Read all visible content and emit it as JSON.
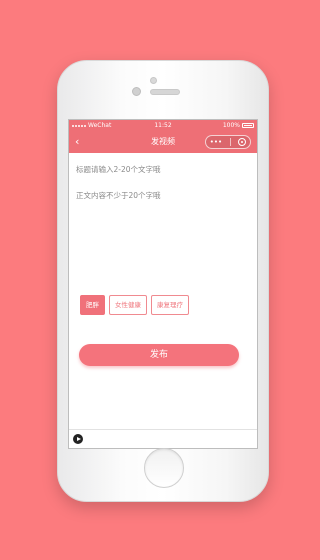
{
  "status_bar": {
    "carrier": "WeChat",
    "time": "11:52",
    "battery": "100%"
  },
  "nav": {
    "back_icon": "chevron-left-icon",
    "title": "发视频",
    "more_icon": "more-dots-icon",
    "close_icon": "target-icon"
  },
  "form": {
    "title_placeholder": "标题请输入2-20个文字哦",
    "body_placeholder": "正文内容不少于20个字哦"
  },
  "tags": [
    {
      "label": "肥胖",
      "selected": true
    },
    {
      "label": "女性健康",
      "selected": false
    },
    {
      "label": "康复理疗",
      "selected": false
    }
  ],
  "publish_label": "发布",
  "colors": {
    "background": "#fc7b7e",
    "accent": "#ee6f76"
  }
}
